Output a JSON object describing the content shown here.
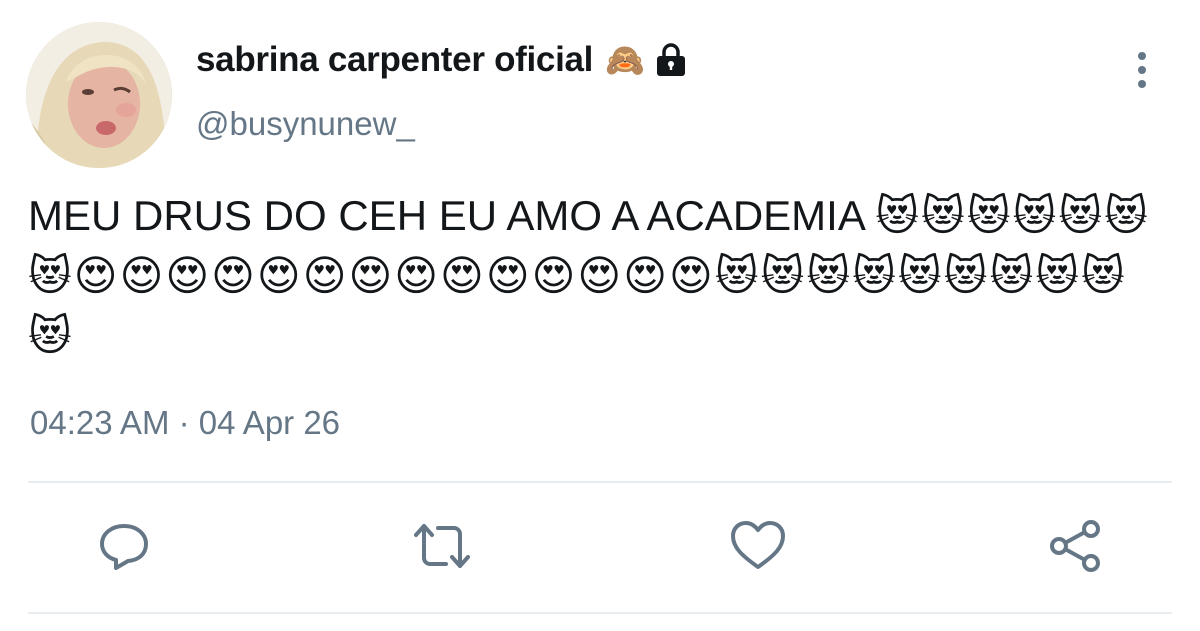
{
  "tweet": {
    "author": {
      "display_name": "sabrina carpenter oficial",
      "name_emoji": "🙈",
      "locked_icon": "lock-icon",
      "handle": "@busynunew_"
    },
    "text": "MEU DRUS DO CEH EU AMO A ACADEMIA ",
    "emoji_run": "😻😻😻😻😻😻😻😍😍😍😍😍😍😍😍😍😍😍😍😍😍😻😻😻😻😻😻😻😻😻😻",
    "timestamp": "04:23 AM · 04 Apr 26",
    "actions": [
      {
        "name": "reply",
        "icon": "reply-icon"
      },
      {
        "name": "retweet",
        "icon": "retweet-icon"
      },
      {
        "name": "like",
        "icon": "heart-icon"
      },
      {
        "name": "share",
        "icon": "share-icon"
      }
    ],
    "menu_icon": "more-vertical-icon"
  },
  "colors": {
    "text_primary": "#14171a",
    "text_secondary": "#657786",
    "divider": "#e6ecf0",
    "icon": "#657786"
  }
}
